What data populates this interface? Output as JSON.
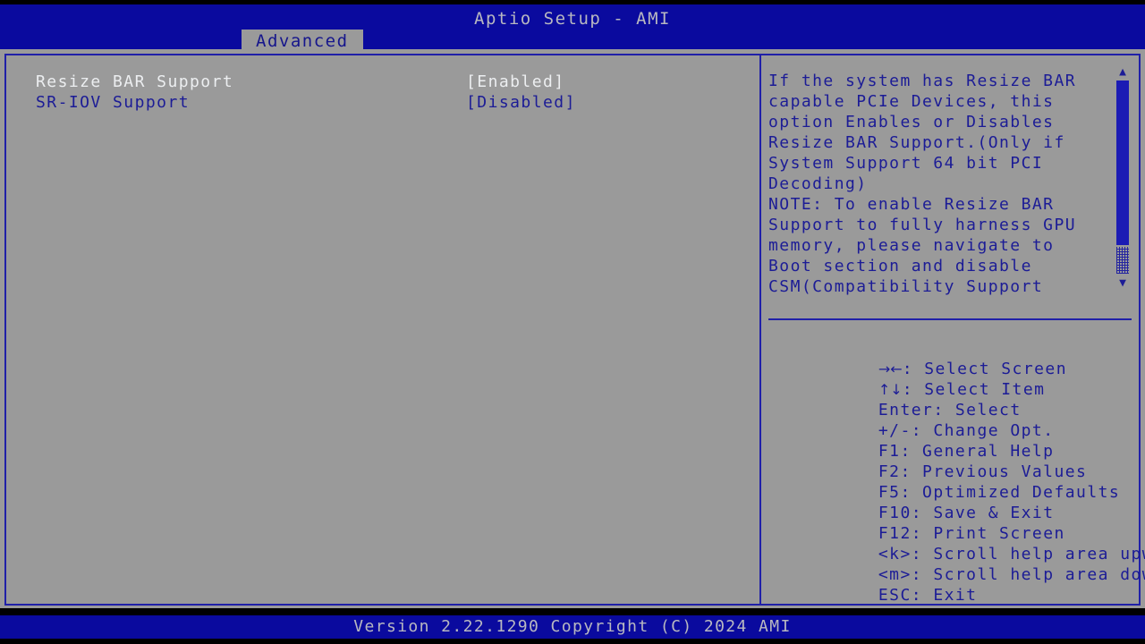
{
  "header": {
    "title": "Aptio Setup - AMI",
    "tabs": [
      {
        "label": "Advanced",
        "active": true
      }
    ]
  },
  "main": {
    "settings": [
      {
        "label": "Resize BAR Support",
        "value": "[Enabled]",
        "selected": true
      },
      {
        "label": "SR-IOV Support",
        "value": "[Disabled]",
        "selected": false
      }
    ]
  },
  "help": {
    "text": "If the system has Resize BAR\ncapable PCIe Devices, this\noption Enables or Disables\nResize BAR Support.(Only if\nSystem Support 64 bit PCI\nDecoding)\nNOTE: To enable Resize BAR\nSupport to fully harness GPU\nmemory, please navigate to\nBoot section and disable\nCSM(Compatibility Support",
    "scrollbar": {
      "up_arrow": "▲",
      "down_arrow": "▼"
    }
  },
  "legend": [
    {
      "key": "→←",
      "glyph": true,
      "desc": ": Select Screen"
    },
    {
      "key": "↑↓",
      "glyph": true,
      "desc": ": Select Item"
    },
    {
      "key": "Enter",
      "glyph": false,
      "desc": ": Select"
    },
    {
      "key": "+/-",
      "glyph": false,
      "desc": ": Change Opt."
    },
    {
      "key": "F1",
      "glyph": false,
      "desc": ": General Help"
    },
    {
      "key": "F2",
      "glyph": false,
      "desc": ": Previous Values"
    },
    {
      "key": "F5",
      "glyph": false,
      "desc": ": Optimized Defaults"
    },
    {
      "key": "F10",
      "glyph": false,
      "desc": ": Save & Exit"
    },
    {
      "key": "F12",
      "glyph": false,
      "desc": ": Print Screen"
    },
    {
      "key": "<k>",
      "glyph": false,
      "desc": ": Scroll help area upwards"
    },
    {
      "key": "<m>",
      "glyph": false,
      "desc": ": Scroll help area downwards"
    },
    {
      "key": "ESC",
      "glyph": false,
      "desc": ": Exit"
    }
  ],
  "footer": {
    "version_text": "Version 2.22.1290 Copyright (C) 2024 AMI"
  },
  "colors": {
    "background_blue": "#0a0a9e",
    "panel_gray": "#9a9a9a",
    "text_blue": "#1c1c96",
    "text_selected": "#eceef0",
    "border_blue": "#2020a8",
    "scrollbar_thumb": "#1b1bb4"
  }
}
